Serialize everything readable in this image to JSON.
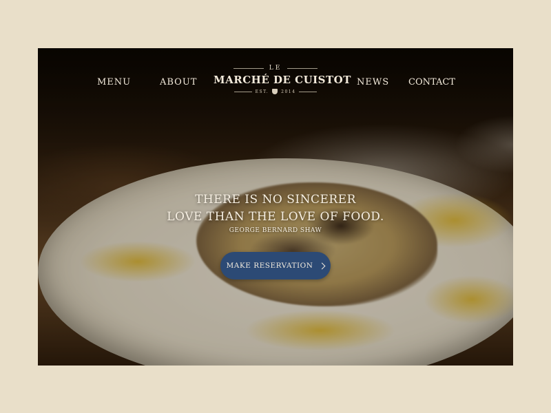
{
  "nav": {
    "menu": "MENU",
    "about": "ABOUT",
    "news": "NEWS",
    "contact": "CONTACT"
  },
  "logo": {
    "le": "LE",
    "name": "MARCHÉ DE CUISTOT",
    "est": "EST.",
    "year": "2014"
  },
  "hero": {
    "quote_line1": "THERE IS NO SINCERER",
    "quote_line2": "LOVE THAN THE LOVE OF FOOD.",
    "author": "GEORGE BERNARD SHAW",
    "cta_label": "MAKE RESERVATION",
    "cta_icon": "chevron-right-icon",
    "cta_color": "#2c4a75"
  },
  "colors": {
    "page_background": "#e9dfc9",
    "text_light": "#f3eadb"
  }
}
